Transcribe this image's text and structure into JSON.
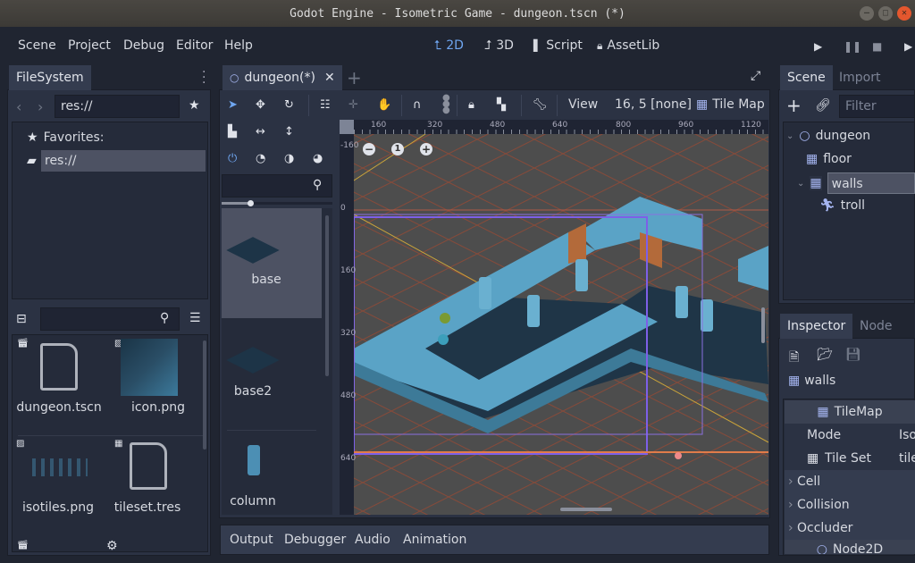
{
  "window": {
    "title": "Godot Engine - Isometric Game - dungeon.tscn (*)"
  },
  "menu": {
    "items": [
      "Scene",
      "Project",
      "Debug",
      "Editor",
      "Help"
    ]
  },
  "modes": [
    {
      "label": "2D",
      "icon": "2d-icon",
      "active": true
    },
    {
      "label": "3D",
      "icon": "3d-icon",
      "active": false
    },
    {
      "label": "Script",
      "icon": "script-icon",
      "active": false
    },
    {
      "label": "AssetLib",
      "icon": "assetlib-icon",
      "active": false
    }
  ],
  "playback": [
    "play-icon",
    "pause-icon",
    "stop-icon",
    "play-scene-icon"
  ],
  "filesystem": {
    "tab": "FileSystem",
    "path": "res://",
    "favorites_label": "Favorites:",
    "tree_items": [
      "res://"
    ],
    "search_placeholder": "",
    "files": [
      {
        "name": "dungeon.tscn",
        "type": "scene"
      },
      {
        "name": "icon.png",
        "type": "image"
      },
      {
        "name": "isotiles.png",
        "type": "image"
      },
      {
        "name": "tileset.tres",
        "type": "tileset"
      }
    ]
  },
  "editor": {
    "scene_tab": "dungeon(*)",
    "toolbar": {
      "view_label": "View",
      "cell_info": "16, 5 [none]",
      "tilemap_label": "Tile Map"
    },
    "ruler_h": [
      "160",
      "320",
      "480",
      "640",
      "800",
      "960",
      "1120"
    ],
    "ruler_v": [
      "-160",
      "0",
      "160",
      "320",
      "480",
      "640"
    ],
    "zoom_level": "1",
    "tiles": [
      "base",
      "base2",
      "column"
    ]
  },
  "bottom_tabs": [
    "Output",
    "Debugger",
    "Audio",
    "Animation"
  ],
  "scene_dock": {
    "tabs": [
      "Scene",
      "Import"
    ],
    "filter_placeholder": "Filter nodes",
    "nodes": [
      {
        "name": "dungeon",
        "icon": "node2d-icon",
        "level": 0
      },
      {
        "name": "floor",
        "icon": "tilemap-icon",
        "level": 1
      },
      {
        "name": "walls",
        "icon": "tilemap-icon",
        "level": 1,
        "selected": true
      },
      {
        "name": "troll",
        "icon": "kinematic-body-icon",
        "level": 2
      }
    ]
  },
  "inspector": {
    "tabs": [
      "Inspector",
      "Node"
    ],
    "object_name": "walls",
    "section": "TileMap",
    "properties": [
      {
        "name": "Mode",
        "value": "Isometric"
      },
      {
        "name": "Tile Set",
        "value": "tileset.tres"
      }
    ],
    "groups": [
      "Cell",
      "Collision",
      "Occluder"
    ],
    "next_section": "Node2D"
  }
}
